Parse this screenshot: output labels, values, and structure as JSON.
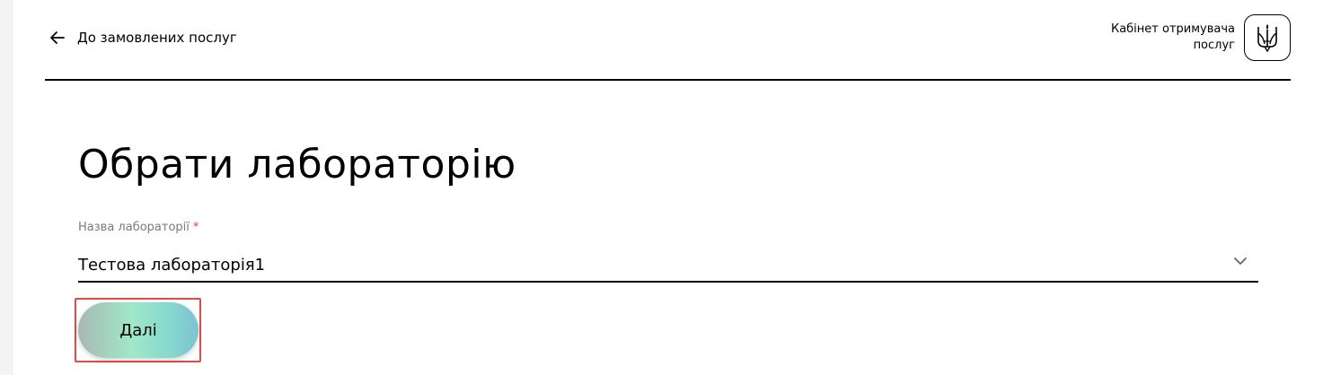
{
  "header": {
    "back_label": "До замовлених послуг",
    "cabinet_title_line1": "Кабінет отримувача",
    "cabinet_title_line2": "послуг"
  },
  "main": {
    "title": "Обрати лабораторію",
    "lab_field": {
      "label": "Назва лабораторії",
      "required_mark": "*",
      "selected_value": "Тестова лабораторія1"
    },
    "next_button_label": "Далі"
  },
  "icons": {
    "back": "arrow-left-icon",
    "logo": "trident-icon",
    "dropdown": "chevron-down-icon"
  },
  "colors": {
    "required": "#d64545",
    "highlight": "#e04a4a",
    "button_gradient": [
      "#a9b8b4",
      "#9fe8c8",
      "#86d9cf",
      "#7cc3d2"
    ]
  }
}
